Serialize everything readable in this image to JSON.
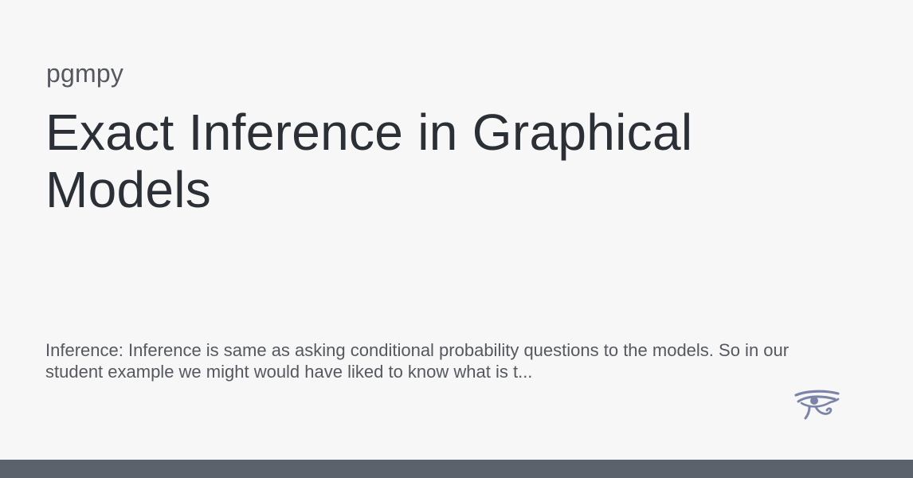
{
  "site": {
    "name": "pgmpy"
  },
  "page": {
    "title": "Exact Inference in Graphical Models",
    "description": "Inference: Inference is same as asking conditional probability questions to the models. So in our student example we might would have liked to know what is t..."
  },
  "logo": {
    "icon": "eye-of-horus-icon",
    "color": "#7b84a8"
  },
  "colors": {
    "background": "#f7f7f7",
    "title": "#2b2f36",
    "muted_text": "#55595f",
    "bottom_bar": "#5c626c"
  }
}
